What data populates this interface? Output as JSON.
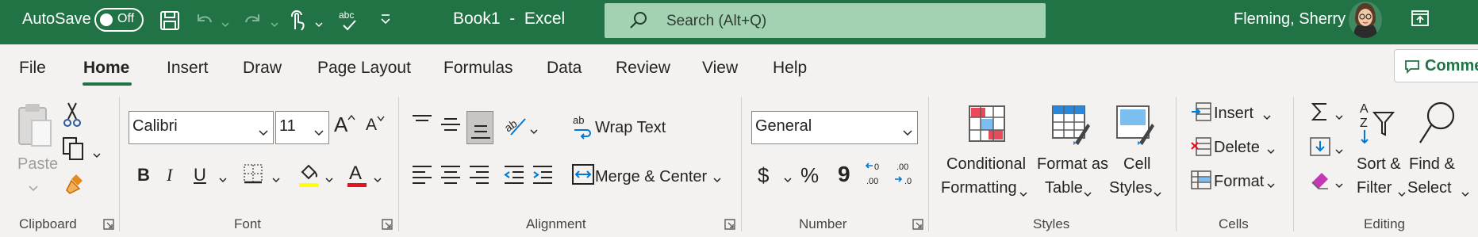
{
  "titlebar": {
    "autosave_label": "AutoSave",
    "autosave_state": "Off",
    "doc_title": "Book1  -  Excel",
    "search_placeholder": "Search (Alt+Q)",
    "user_name": "Fleming, Sherry"
  },
  "tabs": [
    "File",
    "Home",
    "Insert",
    "Draw",
    "Page Layout",
    "Formulas",
    "Data",
    "Review",
    "View",
    "Help"
  ],
  "active_tab": "Home",
  "comments_label": "Comme",
  "clipboard": {
    "paste_label": "Paste",
    "group_label": "Clipboard"
  },
  "font": {
    "font_name": "Calibri",
    "font_size": "11",
    "grow_label": "A",
    "shrink_label": "A",
    "bold": "B",
    "italic": "I",
    "underline": "U",
    "group_label": "Font"
  },
  "alignment": {
    "wrap_text": "Wrap Text",
    "merge_center": "Merge & Center",
    "group_label": "Alignment"
  },
  "number": {
    "format": "General",
    "currency": "$",
    "percent": "%",
    "comma": "9",
    "group_label": "Number"
  },
  "styles": {
    "conditional_line1": "Conditional",
    "conditional_line2": "Formatting",
    "table_line1": "Format as",
    "table_line2": "Table",
    "cell_line1": "Cell",
    "cell_line2": "Styles",
    "group_label": "Styles"
  },
  "cells": {
    "insert": "Insert",
    "delete": "Delete",
    "format": "Format",
    "group_label": "Cells"
  },
  "editing": {
    "sort_line1": "Sort &",
    "sort_line2": "Filter",
    "find_line1": "Find &",
    "find_line2": "Select",
    "group_label": "Editing"
  },
  "colors": {
    "title_green": "#217346",
    "search_bg": "#a3d2b3",
    "ribbon_bg": "#f3f2f1",
    "highlight_yellow": "#ffff00",
    "font_red": "#e81123"
  }
}
